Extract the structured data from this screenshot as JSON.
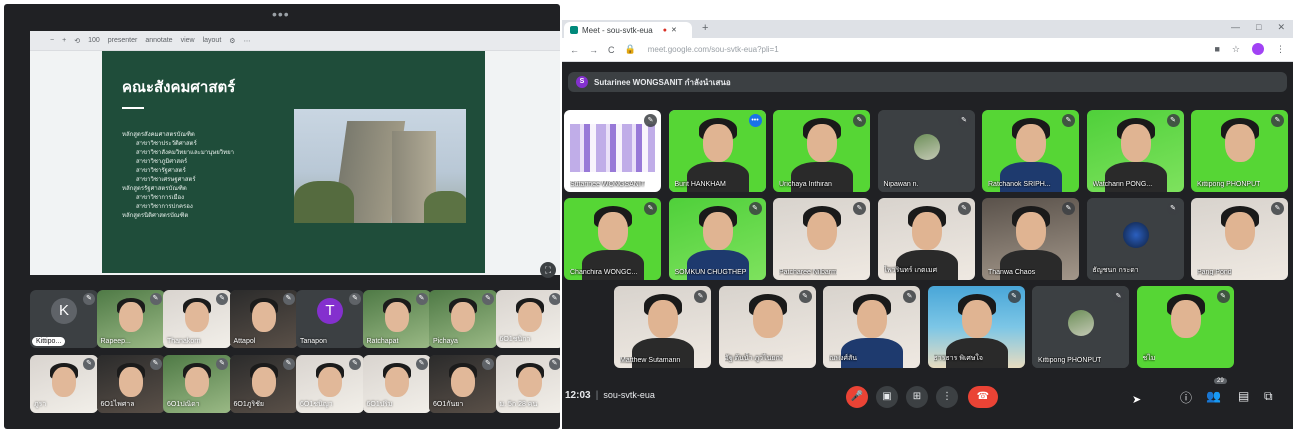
{
  "left_window": {
    "more_menu": "•••",
    "slide_caption": "",
    "toolbar": [
      "−",
      "+",
      "⟲",
      "100",
      "presenter",
      "annotate",
      "view",
      "layout",
      "⚙",
      "⋯"
    ],
    "slide": {
      "title": "คณะสังคมศาสตร์",
      "list": [
        {
          "text": "หลักสูตรสังคมศาสตรบัณฑิต",
          "sub": false
        },
        {
          "text": "สาขาวิชาประวัติศาสตร์",
          "sub": true
        },
        {
          "text": "สาขาวิชาสังคมวิทยาและมานุษยวิทยา",
          "sub": true
        },
        {
          "text": "สาขาวิชาภูมิศาสตร์",
          "sub": true
        },
        {
          "text": "สาขาวิชารัฐศาสตร์",
          "sub": true
        },
        {
          "text": "สาขาวิชาเศรษฐศาสตร์",
          "sub": true
        },
        {
          "text": "หลักสูตรรัฐศาสตรบัณฑิต",
          "sub": false
        },
        {
          "text": "สาขาวิชาการเมือง",
          "sub": true
        },
        {
          "text": "สาขาวิชาการปกครอง",
          "sub": true
        },
        {
          "text": "หลักสูตรนิติศาสตรบัณฑิต",
          "sub": false
        }
      ]
    },
    "thumbs": [
      {
        "name": "Kittipo...",
        "type": "avatar",
        "letter": "K",
        "color": "#5f6368",
        "pinned": true
      },
      {
        "name": "Rapeep...",
        "type": "face",
        "bg": "green"
      },
      {
        "name": "Thanakorn",
        "type": "face",
        "bg": "light"
      },
      {
        "name": "Attapol",
        "type": "face",
        "bg": "dark"
      },
      {
        "name": "Tanapon",
        "type": "avatar",
        "letter": "T",
        "color": "#8430ce"
      },
      {
        "name": "Ratchapat",
        "type": "face",
        "bg": "green"
      },
      {
        "name": "Pichaya",
        "type": "face",
        "bg": "green"
      },
      {
        "name": "6O1ชนิกา",
        "type": "face",
        "bg": "light"
      },
      {
        "name": "ภูรา",
        "type": "face",
        "bg": "light"
      },
      {
        "name": "6O1ไพศาล",
        "type": "face",
        "bg": "dark"
      },
      {
        "name": "6O1ปณิดา",
        "type": "face",
        "bg": "green"
      },
      {
        "name": "6O1ภูริชัย",
        "type": "face",
        "bg": "dark"
      },
      {
        "name": "6O1ชนิญา",
        "type": "face",
        "bg": "light"
      },
      {
        "name": "6O1ปริม",
        "type": "face",
        "bg": "light"
      },
      {
        "name": "6O1กันยา",
        "type": "face",
        "bg": "dark"
      },
      {
        "name": "ม. 5ก 28 คน",
        "type": "face",
        "bg": "light"
      }
    ]
  },
  "browser": {
    "tab_title": "Meet - sou-svtk-eua",
    "new_tab": "+",
    "window_controls": [
      "—",
      "□",
      "✕"
    ],
    "url": "meet.google.com/sou-svtk-eua?pli=1",
    "presenter_label": "Sutarinee WONGSANIT กำลังนำเสนอ",
    "tiles": [
      {
        "name": "Sutarinee WONGSANIT",
        "bg": "screen",
        "kind": "screen"
      },
      {
        "name": "Burit HANKHAM",
        "bg": "gs",
        "kind": "face",
        "speaking": true,
        "shoulders": "dk"
      },
      {
        "name": "Urichaya Inthiran",
        "bg": "gs",
        "kind": "face",
        "shoulders": "dk"
      },
      {
        "name": "Nipawan n.",
        "bg": "grey",
        "kind": "avatar"
      },
      {
        "name": "Ratchanok SRIPH...",
        "bg": "gs",
        "kind": "face",
        "shoulders": "bl"
      },
      {
        "name": "Watcharin PONG...",
        "bg": "gs2",
        "kind": "face",
        "shoulders": "dk"
      },
      {
        "name": "Kittipong PHONPUT",
        "bg": "gs",
        "kind": "face",
        "shoulders": ""
      },
      {
        "name": "Chanchira WONGC...",
        "bg": "gs",
        "kind": "face",
        "shoulders": "dk"
      },
      {
        "name": "SOMKUN CHUGTHEP",
        "bg": "gs2",
        "kind": "face",
        "shoulders": "bl"
      },
      {
        "name": "Patcharee Nilbarm",
        "bg": "room",
        "kind": "face",
        "shoulders": ""
      },
      {
        "name": "ไพวรินทร์ เกตเมศ",
        "bg": "room",
        "kind": "face",
        "shoulders": "dk"
      },
      {
        "name": "Thanwa Chaos",
        "bg": "roomd",
        "kind": "face",
        "shoulders": "dk"
      },
      {
        "name": "ธัญชนก กระดา",
        "bg": "grey",
        "kind": "avatar-blue"
      },
      {
        "name": "Pang Pond",
        "bg": "room",
        "kind": "face",
        "shoulders": ""
      },
      {
        "name": "Matthew Sutamann",
        "bg": "room",
        "kind": "face",
        "shoulders": "dk"
      },
      {
        "name": "อัฐ ต้นน้ำ ภูวไนยกร",
        "bg": "room",
        "kind": "face",
        "shoulders": ""
      },
      {
        "name": "ณพงศ์สัน",
        "bg": "room",
        "kind": "face",
        "shoulders": "bl"
      },
      {
        "name": "ธารธาร พิเศษใจ",
        "bg": "beach",
        "kind": "face",
        "shoulders": "dk"
      },
      {
        "name": "Kittipong PHONPUT",
        "bg": "grey",
        "kind": "avatar"
      },
      {
        "name": "ชไม",
        "bg": "gs",
        "kind": "face",
        "shoulders": ""
      }
    ],
    "bottom": {
      "time": "12:03",
      "sep": "|",
      "meeting_code": "sou-svtk-eua",
      "participant_count": "29",
      "controls": {
        "mic": "🎤",
        "camera": "▣",
        "present": "⊞",
        "more": "⋮",
        "leave": "☎"
      },
      "right_controls": {
        "info": "ⓘ",
        "people": "👥",
        "chat": "▤",
        "activities": "⧉"
      }
    }
  },
  "colors": {
    "meet_dark": "#202124",
    "tile_grey": "#3c4043",
    "slide_green": "#1f4d3a",
    "leave_red": "#ea4335",
    "speaking_blue": "#1a73e8"
  }
}
